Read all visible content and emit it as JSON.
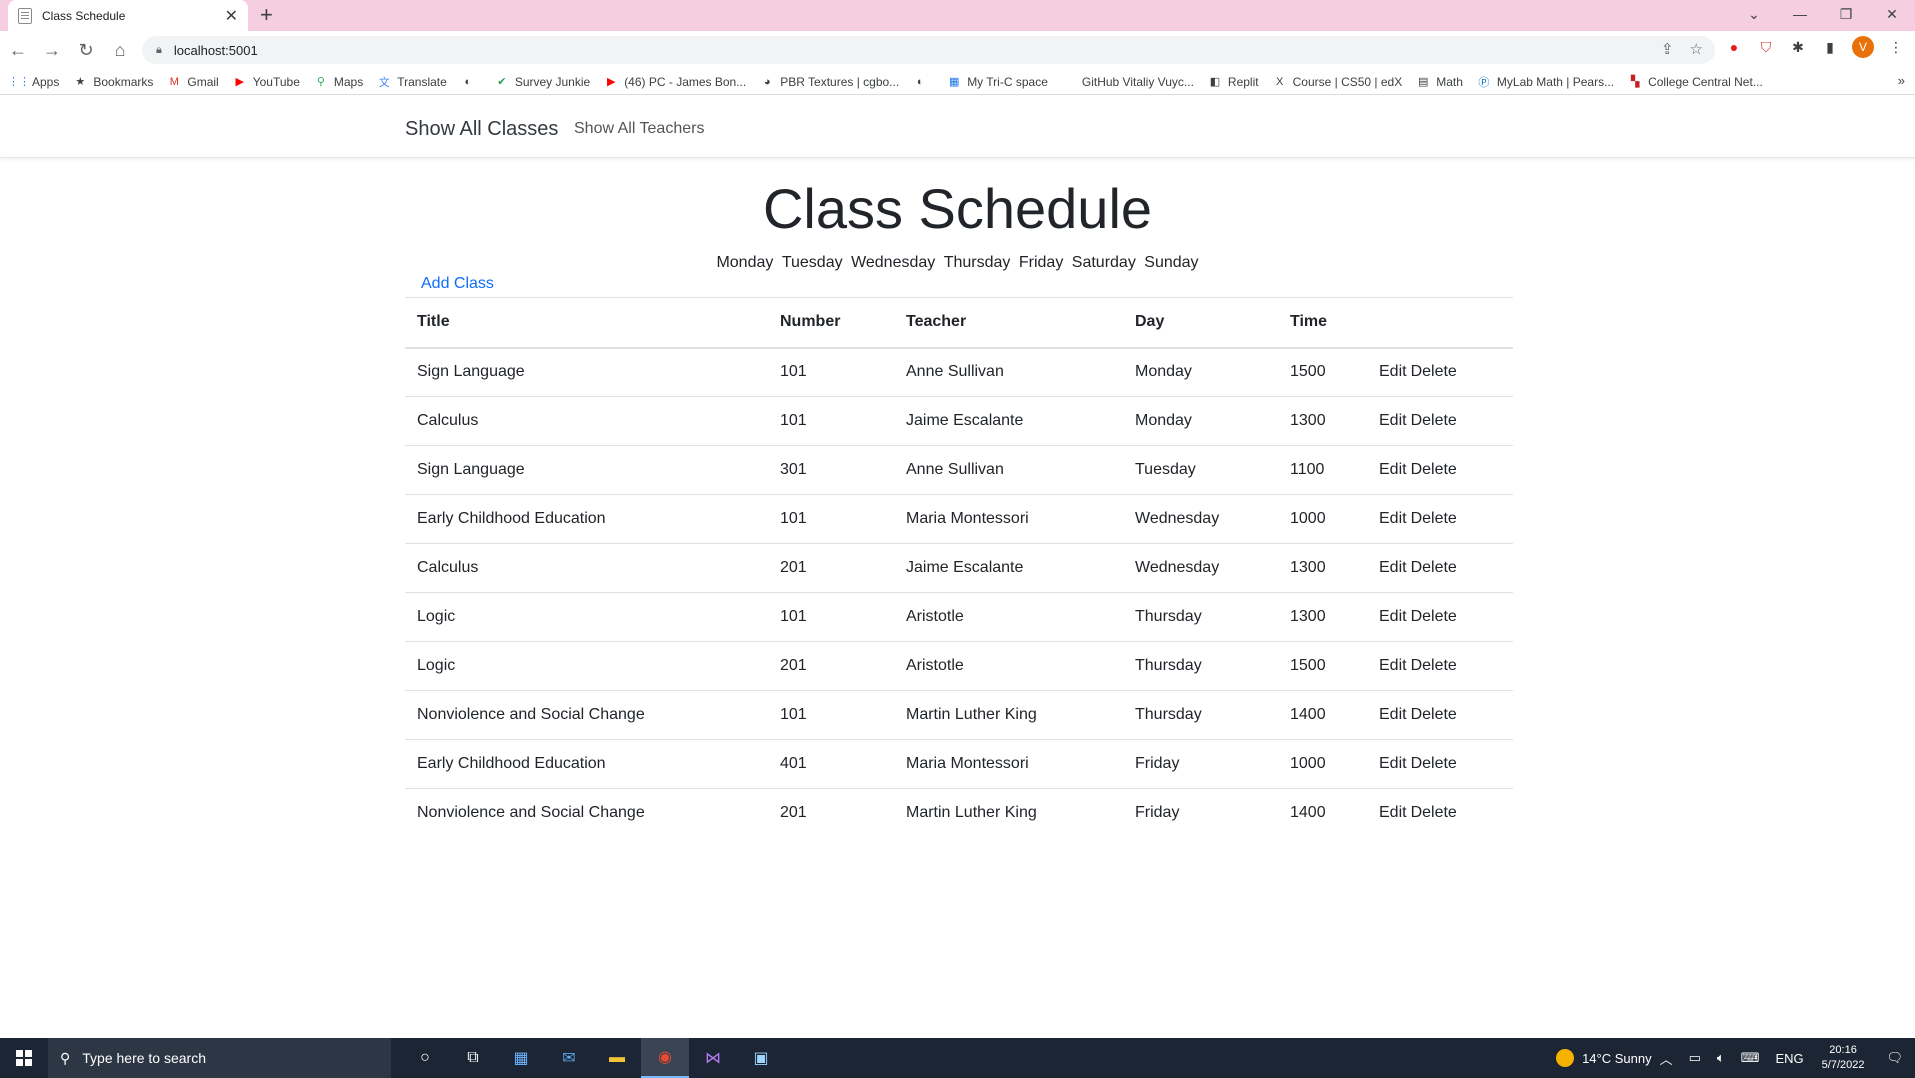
{
  "browser": {
    "tab_title": "Class Schedule",
    "url": "localhost:5001",
    "profile_initial": "V",
    "bookmarks": [
      {
        "label": "Apps",
        "icon": "apps-grid-icon"
      },
      {
        "label": "Bookmarks",
        "icon": "star-icon"
      },
      {
        "label": "Gmail",
        "icon": "gmail-icon"
      },
      {
        "label": "YouTube",
        "icon": "youtube-icon"
      },
      {
        "label": "Maps",
        "icon": "maps-pin-icon"
      },
      {
        "label": "Translate",
        "icon": "translate-icon"
      },
      {
        "label": "",
        "icon": "globe-icon"
      },
      {
        "label": "Survey Junkie",
        "icon": "check-icon"
      },
      {
        "label": "(46) PC - James Bon...",
        "icon": "youtube-icon"
      },
      {
        "label": "PBR Textures | cgbo...",
        "icon": "palette-icon"
      },
      {
        "label": "",
        "icon": "globe-icon"
      },
      {
        "label": "My Tri-C space",
        "icon": "grid-icon"
      },
      {
        "label": "GitHub Vitaliy Vuyc...",
        "icon": "blank-icon"
      },
      {
        "label": "Replit",
        "icon": "replit-icon"
      },
      {
        "label": "Course | CS50 | edX",
        "icon": "edx-icon"
      },
      {
        "label": "Math",
        "icon": "doc-icon"
      },
      {
        "label": "MyLab Math | Pears...",
        "icon": "pearson-icon"
      },
      {
        "label": "College Central Net...",
        "icon": "college-icon"
      }
    ]
  },
  "site_nav": {
    "brand": "Show All Classes",
    "teachers_link": "Show All Teachers"
  },
  "page": {
    "heading": "Class Schedule",
    "days": [
      "Monday",
      "Tuesday",
      "Wednesday",
      "Thursday",
      "Friday",
      "Saturday",
      "Sunday"
    ],
    "add_class": "Add Class"
  },
  "table": {
    "headers": [
      "Title",
      "Number",
      "Teacher",
      "Day",
      "Time"
    ],
    "edit_label": "Edit",
    "delete_label": "Delete",
    "rows": [
      [
        "Sign Language",
        "101",
        "Anne Sullivan",
        "Monday",
        "1500"
      ],
      [
        "Calculus",
        "101",
        "Jaime Escalante",
        "Monday",
        "1300"
      ],
      [
        "Sign Language",
        "301",
        "Anne Sullivan",
        "Tuesday",
        "1100"
      ],
      [
        "Early Childhood Education",
        "101",
        "Maria Montessori",
        "Wednesday",
        "1000"
      ],
      [
        "Calculus",
        "201",
        "Jaime Escalante",
        "Wednesday",
        "1300"
      ],
      [
        "Logic",
        "101",
        "Aristotle",
        "Thursday",
        "1300"
      ],
      [
        "Logic",
        "201",
        "Aristotle",
        "Thursday",
        "1500"
      ],
      [
        "Nonviolence and Social Change",
        "101",
        "Martin Luther King",
        "Thursday",
        "1400"
      ],
      [
        "Early Childhood Education",
        "401",
        "Maria Montessori",
        "Friday",
        "1000"
      ],
      [
        "Nonviolence and Social Change",
        "201",
        "Martin Luther King",
        "Friday",
        "1400"
      ]
    ]
  },
  "taskbar": {
    "search_placeholder": "Type here to search",
    "weather": "14°C  Sunny",
    "language": "ENG",
    "time": "20:16",
    "date": "5/7/2022"
  }
}
